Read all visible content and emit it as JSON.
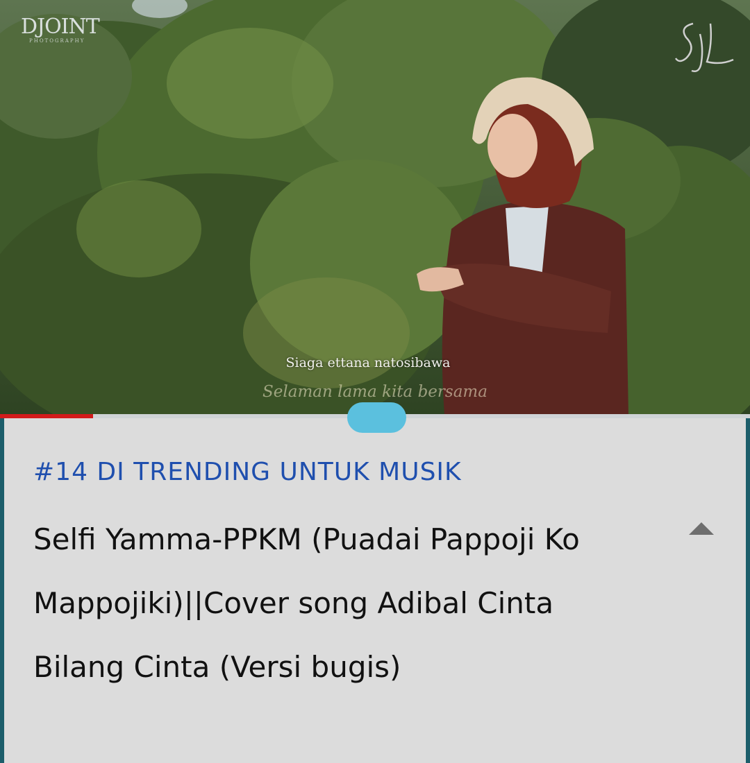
{
  "player": {
    "watermark_left": "DJOINT",
    "watermark_left_sub": "PHOTOGRAPHY",
    "watermark_right_icon": "signature-monogram-icon",
    "subtitle_line1": "Siaga ettana natosibawa",
    "subtitle_line2": "Selaman lama kita bersama",
    "progress_fraction": 0.124
  },
  "panel": {
    "trending_label": "#14 DI TRENDING UNTUK MUSIK",
    "title": "Selfi Yamma-PPKM (Puadai Pappoji Ko Mappojiki)||Cover song Adibal Cinta Bilang Cinta (Versi bugis)",
    "expand_icon": "chevron-up-icon"
  },
  "colors": {
    "trending": "#1f4fae",
    "progress": "#d21b1b",
    "handle": "#5bc0de",
    "panel_bg": "#dcdcdc",
    "border": "#1d5e6b"
  }
}
